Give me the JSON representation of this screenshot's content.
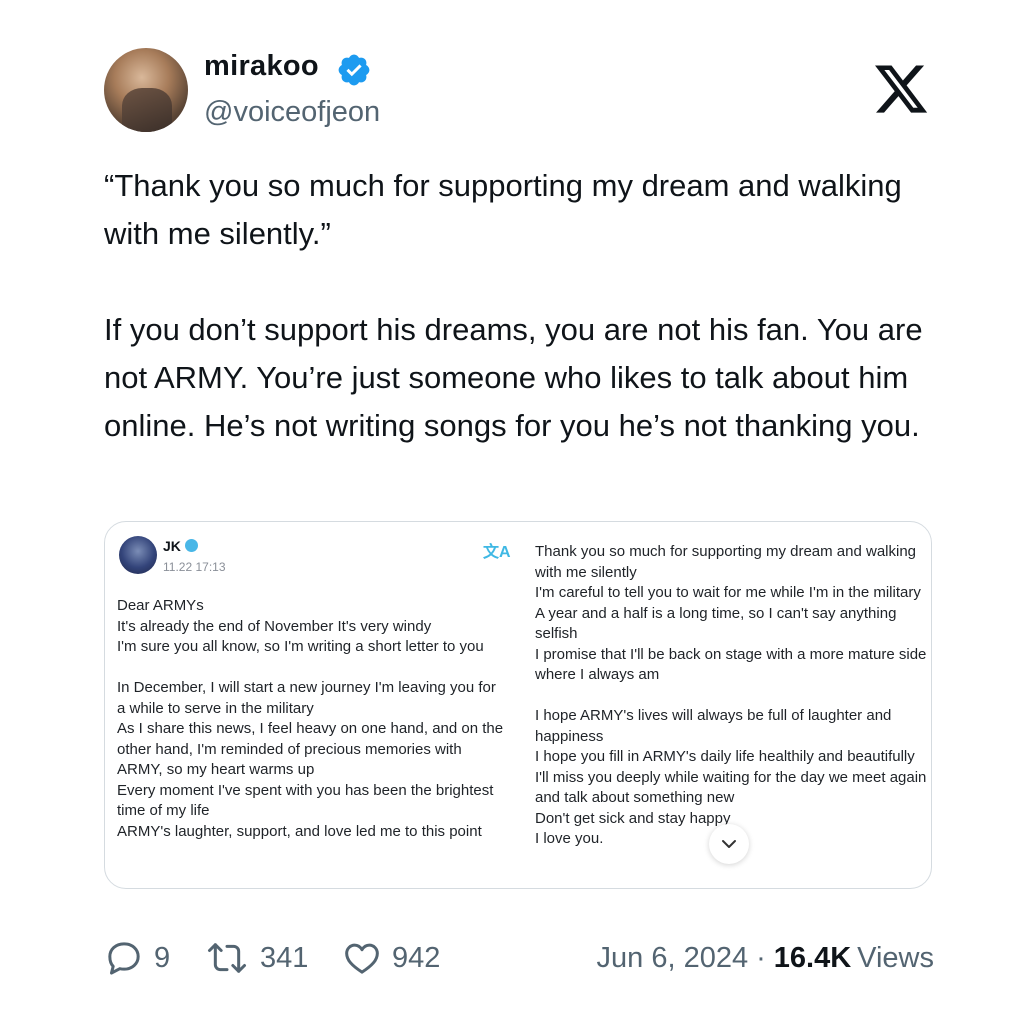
{
  "author": {
    "name": "mirakoo",
    "handle": "@voiceofjeon",
    "verified": true
  },
  "tweet": {
    "quote": "“Thank you so much for supporting my dream and walking with me silently.”",
    "body": [
      "If you don’t support his dreams, you are not his fan. You are not ARMY. You’re just someone who likes to talk about him online. He’s not writing songs for you he’s not thanking you."
    ]
  },
  "media": {
    "post_author": "JK",
    "post_date": "11.22 17:13",
    "translate_glyph": "文A",
    "left_paragraphs": [
      "Dear ARMYs\nIt's already the end of November It's very windy\nI'm sure you all know, so I'm writing a short letter to you",
      "In December, I will start a new journey I'm leaving you for a while to serve in the military\nAs I share this news, I feel heavy on one hand, and on the other hand, I'm reminded of precious memories with ARMY, so my heart warms up\nEvery moment I've spent with you has been the brightest time of my life\nARMY's laughter, support, and love led me to this point"
    ],
    "right_paragraphs": [
      "Thank you so much for supporting my dream and walking with me silently\nI'm careful to tell you to wait for me while I'm in the military A year and a half is a long time, so I can't say anything selfish\nI promise that I'll be back on stage with a more mature side where I always am",
      "I hope ARMY's lives will always be full of laughter and happiness\nI hope you fill in ARMY's daily life healthily and beautifully\nI'll miss you deeply while waiting for the day we meet again and talk about something new\nDon't get sick and stay happy\nI love you."
    ]
  },
  "stats": {
    "replies": "9",
    "reposts": "341",
    "likes": "942",
    "date": "Jun 6, 2024",
    "separator": "·",
    "views": "16.4K",
    "views_label": "Views"
  },
  "colors": {
    "verified": "#1d9bf0",
    "text": "#0f1419",
    "secondary": "#536471",
    "accent_translate": "#3fb8e4"
  },
  "icons": [
    "verified-badge-icon",
    "x-logo-icon",
    "translate-icon",
    "chevron-down-icon",
    "reply-icon",
    "repost-icon",
    "like-icon"
  ]
}
